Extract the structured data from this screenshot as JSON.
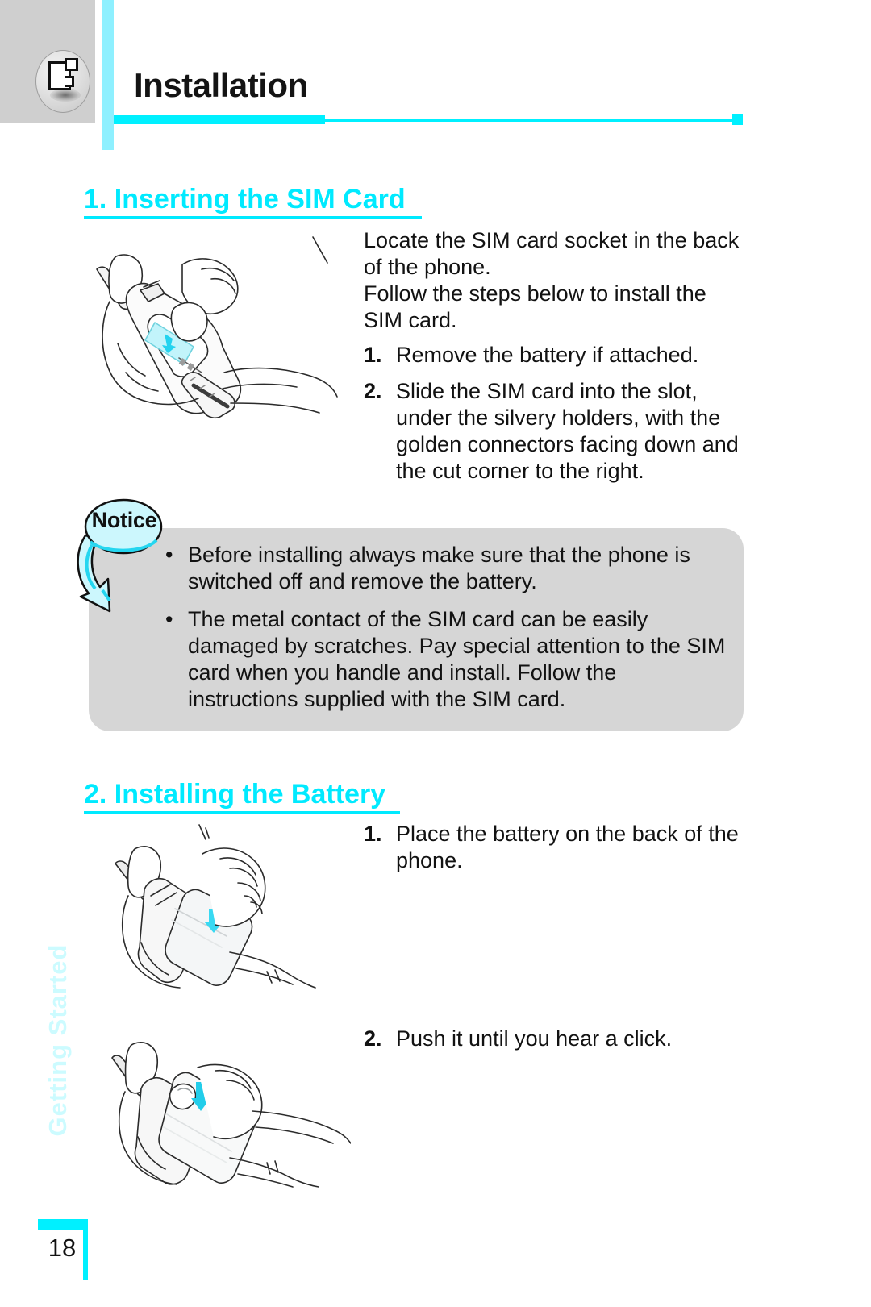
{
  "header": {
    "icon": "document-page-icon",
    "title": "Installation"
  },
  "sidebar": {
    "vertical_tab_label": "Getting Started"
  },
  "footer": {
    "page_number": "18"
  },
  "sections": [
    {
      "heading": "1. Inserting the SIM Card",
      "illustration": "hands-inserting-sim-card-into-phone",
      "paragraphs": [
        "Locate the SIM card socket in the back of the phone.",
        "Follow the steps below to install the SIM card."
      ],
      "steps": [
        {
          "num": "1.",
          "text": "Remove the battery if attached."
        },
        {
          "num": "2.",
          "text": "Slide the SIM card into the slot, under the silvery holders, with the golden connectors facing down and the cut corner to the right."
        }
      ]
    },
    {
      "heading": "2. Installing the Battery",
      "illustrations": [
        "hand-placing-battery-on-back-of-phone",
        "hand-pushing-battery-until-click"
      ],
      "steps": [
        {
          "num": "1.",
          "text": "Place the battery on the back of the phone."
        },
        {
          "num": "2.",
          "text": "Push it until you hear a click."
        }
      ]
    }
  ],
  "notice": {
    "label": "Notice",
    "bullet_char": "•",
    "items": [
      "Before installing always make sure that the phone is switched off and remove the battery.",
      "The metal contact of the SIM card can be easily damaged by scratches. Pay special attention to the SIM card when you handle and install. Follow the instructions supplied with the SIM card."
    ]
  },
  "colors": {
    "accent_cyan": "#00eaff",
    "rule_cyan": "#00f0ff",
    "spine_cyan": "#8ef0ff",
    "tab_cyan": "#ccfbff",
    "header_gray": "#cfcfcf",
    "notice_gray": "#d6d6d6",
    "text_black": "#121212"
  }
}
